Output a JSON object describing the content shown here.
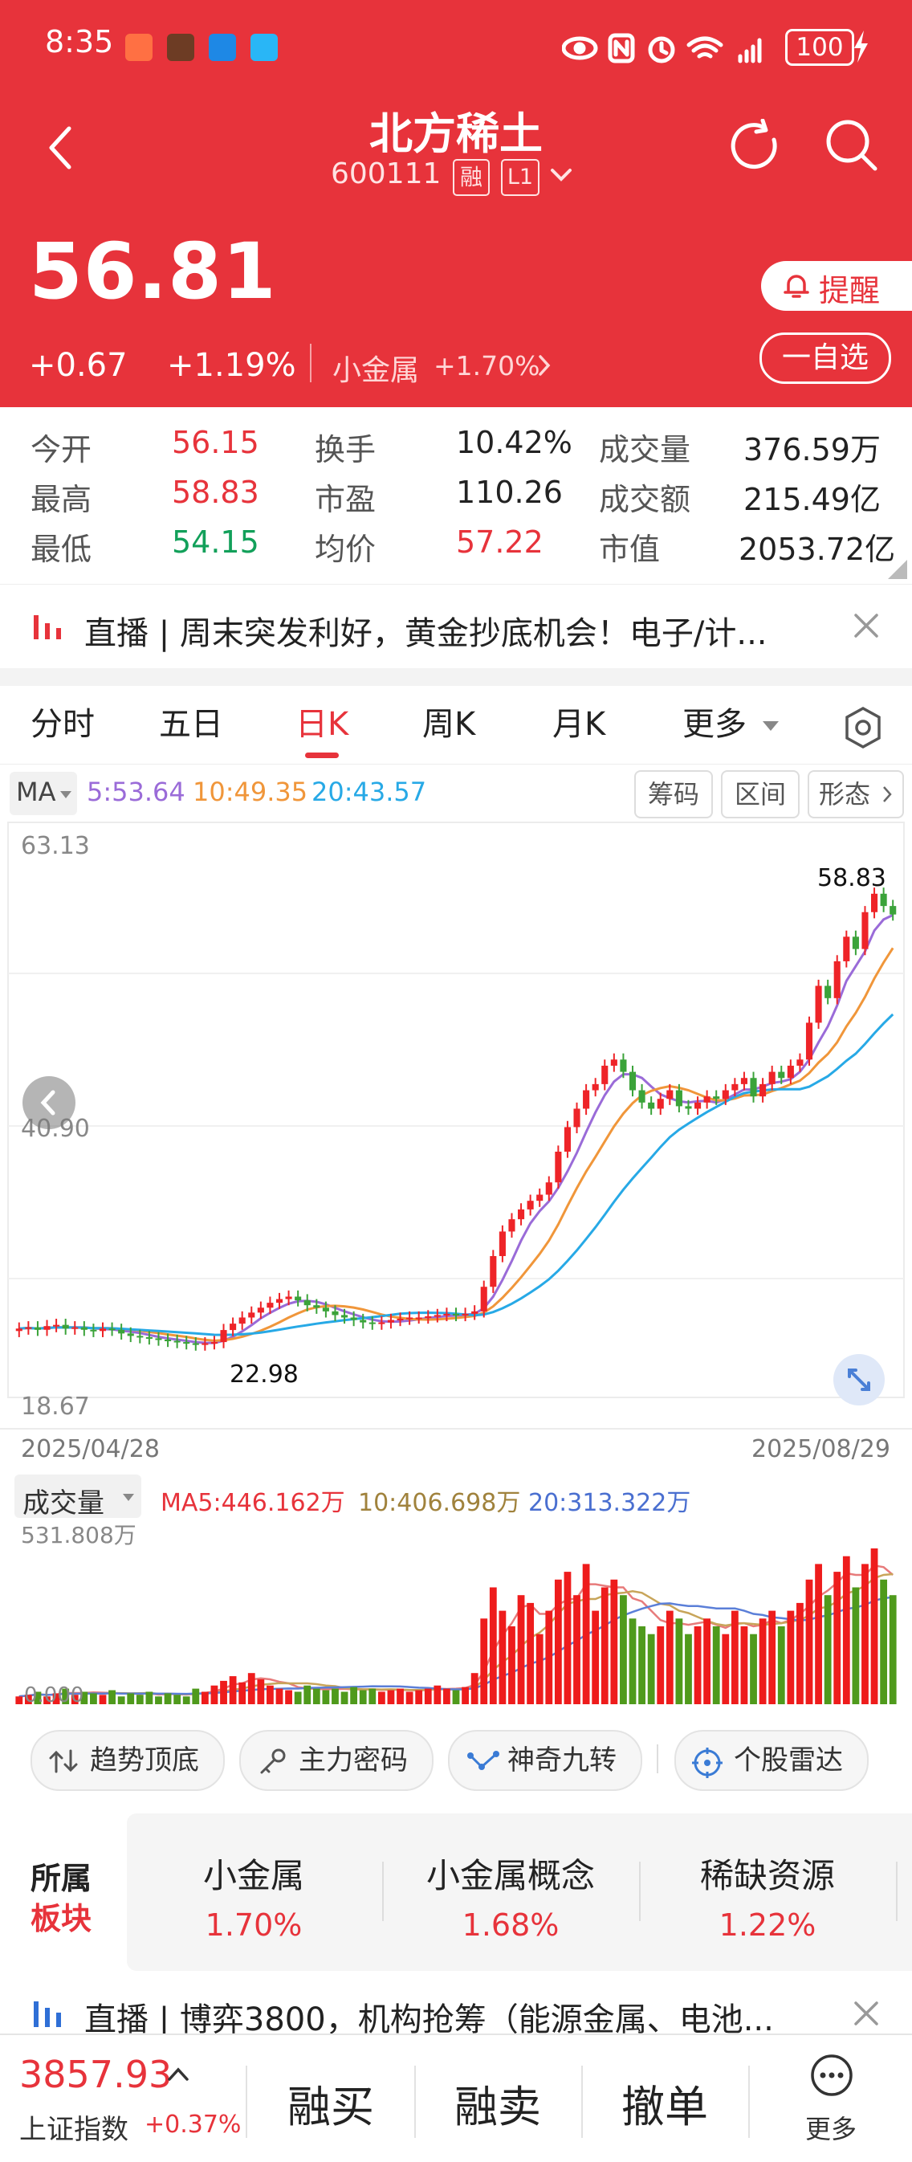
{
  "status_bar": {
    "time": "8:35",
    "battery": "100"
  },
  "header": {
    "name": "北方稀土",
    "code": "600111",
    "badge_rong": "融",
    "badge_level": "L1"
  },
  "price": {
    "last": "56.81",
    "change": "+0.67",
    "change_pct": "+1.19%",
    "sector_name": "小金属",
    "sector_pct": "+1.70%",
    "alert_label": "提醒",
    "watch_label": "一自选"
  },
  "quote": {
    "open_label": "今开",
    "open": "56.15",
    "turnover_label": "换手",
    "turnover": "10.42%",
    "volume_label": "成交量",
    "volume": "376.59万",
    "high_label": "最高",
    "high": "58.83",
    "pe_label": "市盈",
    "pe": "110.26",
    "amount_label": "成交额",
    "amount": "215.49亿",
    "low_label": "最低",
    "low": "54.15",
    "avg_label": "均价",
    "avg": "57.22",
    "mktcap_label": "市值",
    "mktcap": "2053.72亿"
  },
  "banner_top": {
    "text": "直播 | 周末突发利好，黄金抄底机会！电子/计..."
  },
  "tabs": [
    "分时",
    "五日",
    "日K",
    "周K",
    "月K",
    "更多"
  ],
  "ma": {
    "label": "MA",
    "ma5": "5:53.64",
    "ma10": "10:49.35",
    "ma20": "20:43.57",
    "btn_chip": "筹码",
    "btn_range": "区间",
    "btn_shape": "形态"
  },
  "chart_labels": {
    "y_top": "63.13",
    "y_mid": "40.90",
    "y_bottom": "18.67",
    "x_start": "2025/04/28",
    "x_end": "2025/08/29",
    "high_mark": "58.83",
    "low_mark": "22.98"
  },
  "volume": {
    "label": "成交量",
    "ma5": "MA5:446.162万",
    "ma10": "10:406.698万",
    "ma20": "20:313.322万",
    "y_max": "531.808万",
    "y_min": "0.000"
  },
  "tools": [
    "趋势顶底",
    "主力密码",
    "神奇九转",
    "个股雷达"
  ],
  "sectors": {
    "title_a": "所属",
    "title_b": "板块",
    "items": [
      {
        "name": "小金属",
        "pct": "1.70%"
      },
      {
        "name": "小金属概念",
        "pct": "1.68%"
      },
      {
        "name": "稀缺资源",
        "pct": "1.22%"
      }
    ]
  },
  "banner_bottom": {
    "text": "直播 | 博弈3800，机构抢筹（能源金属、电池..."
  },
  "bottom": {
    "index_value": "3857.93",
    "index_name": "上证指数",
    "index_pct": "+0.37%",
    "buy": "融买",
    "sell": "融卖",
    "cancel": "撤单",
    "more": "更多"
  },
  "chart_data": {
    "type": "candlestick",
    "title": "",
    "xlabel": "",
    "ylabel": "",
    "x_range": [
      "2025/04/28",
      "2025/08/29"
    ],
    "ylim": [
      18.67,
      63.13
    ],
    "close": [
      23.1,
      23.2,
      23.0,
      23.3,
      23.4,
      23.1,
      23.2,
      23.0,
      22.9,
      23.1,
      23.0,
      22.7,
      22.5,
      22.4,
      22.3,
      22.2,
      22.1,
      22.0,
      21.9,
      21.8,
      21.9,
      22.0,
      22.98,
      23.5,
      24.0,
      24.4,
      24.8,
      25.2,
      25.5,
      25.7,
      25.4,
      25.0,
      24.8,
      24.5,
      24.2,
      24.0,
      23.8,
      23.6,
      23.5,
      23.6,
      23.8,
      23.9,
      24.0,
      24.0,
      24.1,
      24.2,
      24.3,
      24.2,
      24.3,
      24.5,
      26.5,
      29.0,
      31.0,
      32.0,
      32.8,
      33.5,
      34.0,
      35.0,
      37.5,
      39.5,
      41.0,
      42.5,
      43.0,
      44.5,
      45.0,
      44.0,
      42.5,
      41.5,
      41.0,
      41.8,
      42.5,
      41.2,
      41.0,
      41.5,
      42.0,
      41.8,
      42.5,
      43.0,
      43.5,
      42.0,
      43.0,
      44.0,
      43.5,
      44.5,
      45.0,
      48.0,
      51.0,
      50.0,
      53.0,
      55.0,
      54.0,
      57.0,
      58.5,
      57.5,
      56.81
    ],
    "ma": {
      "ma5": 53.64,
      "ma10": 49.35,
      "ma20": 43.57
    },
    "volume_ma": {
      "ma5": "446.162万",
      "ma10": "406.698万",
      "ma20": "313.322万"
    },
    "volume_ylim": [
      0,
      531.808
    ],
    "volume_ratio": [
      0.05,
      0.06,
      0.08,
      0.05,
      0.07,
      0.1,
      0.06,
      0.08,
      0.07,
      0.06,
      0.09,
      0.05,
      0.07,
      0.06,
      0.08,
      0.05,
      0.07,
      0.06,
      0.05,
      0.1,
      0.08,
      0.12,
      0.15,
      0.18,
      0.14,
      0.2,
      0.16,
      0.12,
      0.1,
      0.09,
      0.08,
      0.12,
      0.1,
      0.09,
      0.1,
      0.08,
      0.11,
      0.09,
      0.1,
      0.08,
      0.09,
      0.1,
      0.08,
      0.09,
      0.1,
      0.12,
      0.1,
      0.09,
      0.11,
      0.2,
      0.55,
      0.75,
      0.6,
      0.5,
      0.7,
      0.65,
      0.45,
      0.6,
      0.8,
      0.85,
      0.7,
      0.9,
      0.6,
      0.75,
      0.8,
      0.7,
      0.55,
      0.5,
      0.45,
      0.5,
      0.6,
      0.55,
      0.45,
      0.5,
      0.55,
      0.5,
      0.45,
      0.6,
      0.5,
      0.45,
      0.55,
      0.6,
      0.5,
      0.6,
      0.65,
      0.8,
      0.9,
      0.7,
      0.85,
      0.95,
      0.75,
      0.9,
      1.0,
      0.8,
      0.7
    ]
  }
}
